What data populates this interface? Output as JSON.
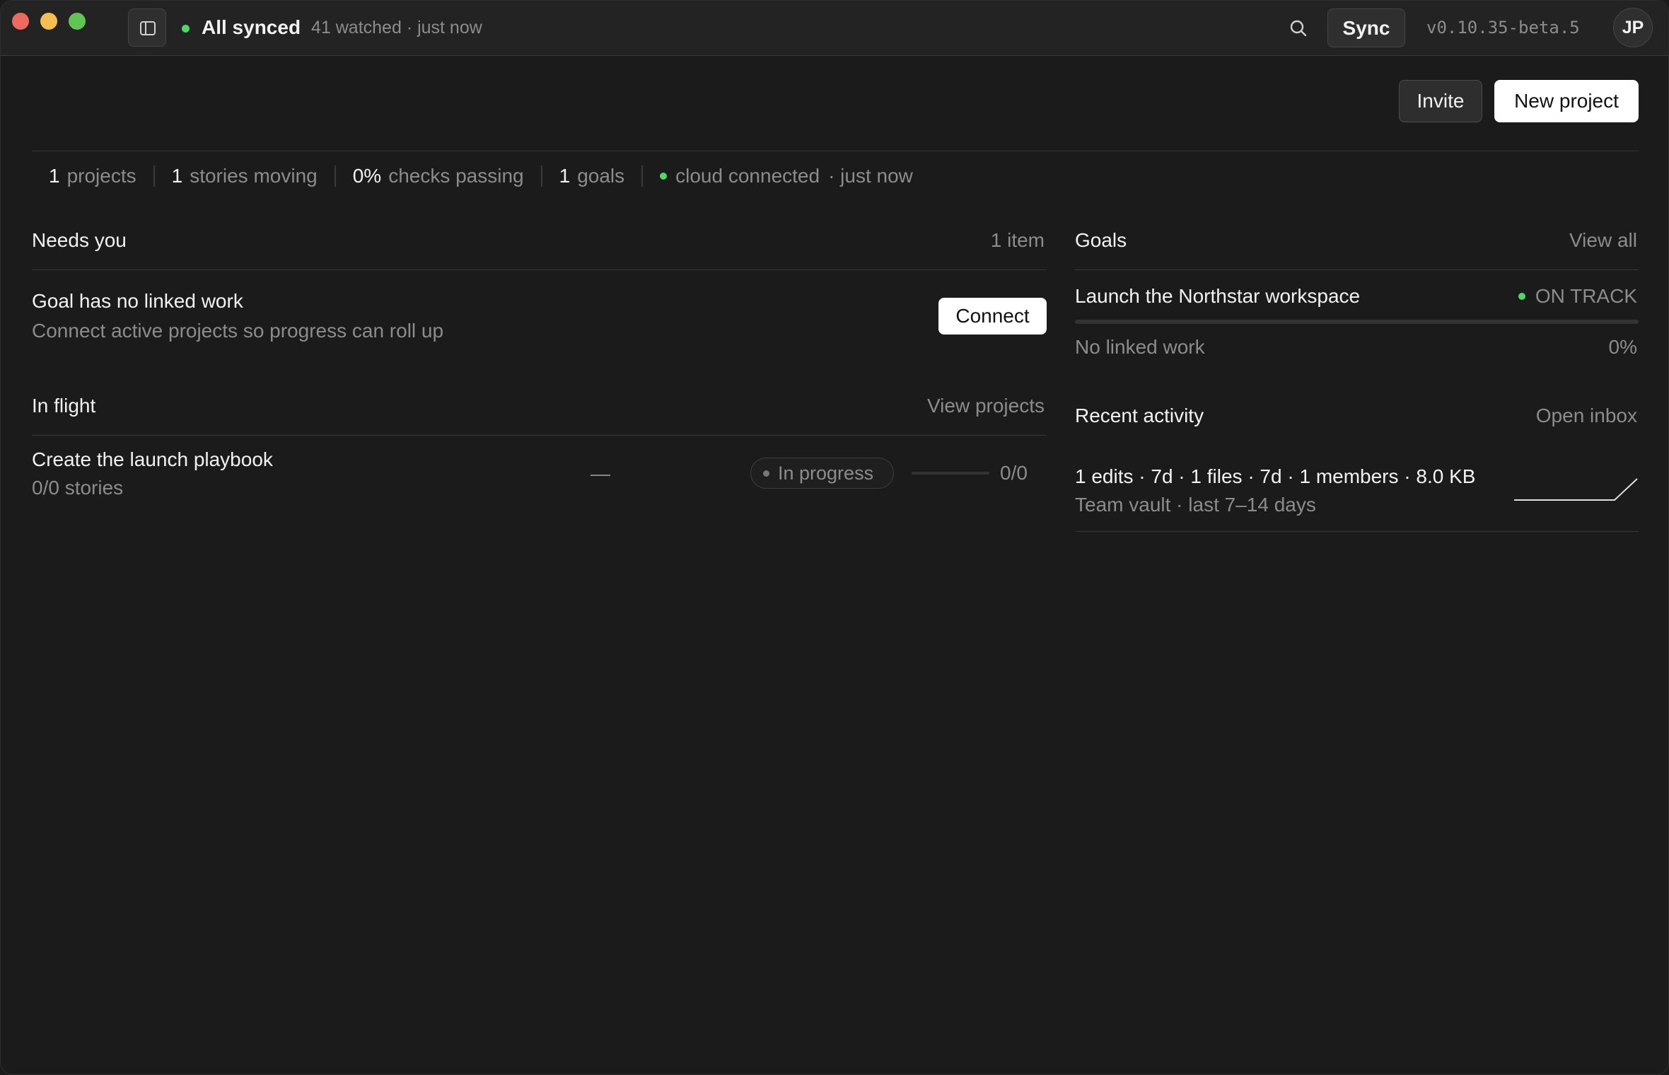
{
  "titlebar": {
    "sync_status": "All synced",
    "sync_meta": "41 watched · just now",
    "sync_button": "Sync",
    "version": "v0.10.35-beta.5",
    "avatar_initials": "JP",
    "status_color": "#4cd964"
  },
  "header": {
    "invite_label": "Invite",
    "new_project_label": "New project"
  },
  "stats": {
    "projects": {
      "num": "1",
      "label": "projects"
    },
    "stories": {
      "num": "1",
      "label": "stories moving"
    },
    "checks": {
      "num": "0%",
      "label": "checks passing"
    },
    "goals": {
      "num": "1",
      "label": "goals"
    },
    "cloud": {
      "label": "cloud connected",
      "time": "· just now"
    }
  },
  "needs_you": {
    "title": "Needs you",
    "count": "1 item",
    "items": [
      {
        "title": "Goal has no linked work",
        "subtitle": "Connect active projects so progress can roll up",
        "action": "Connect"
      }
    ]
  },
  "in_flight": {
    "title": "In flight",
    "link": "View projects",
    "items": [
      {
        "title": "Create the launch playbook",
        "subtitle": "0/0 stories",
        "owner": "—",
        "status": "In progress",
        "progress": 0,
        "count": "0/0"
      }
    ]
  },
  "goals": {
    "title": "Goals",
    "link": "View all",
    "items": [
      {
        "title": "Launch the Northstar workspace",
        "status": "ON TRACK",
        "subtitle": "No linked work",
        "percent": "0%",
        "progress": 0
      }
    ]
  },
  "recent_activity": {
    "title": "Recent activity",
    "link": "Open inbox",
    "items": [
      {
        "summary": "1 edits · 7d · 1 files · 7d · 1 members · 8.0 KB",
        "subtitle": "Team vault · last 7–14 days"
      }
    ]
  }
}
